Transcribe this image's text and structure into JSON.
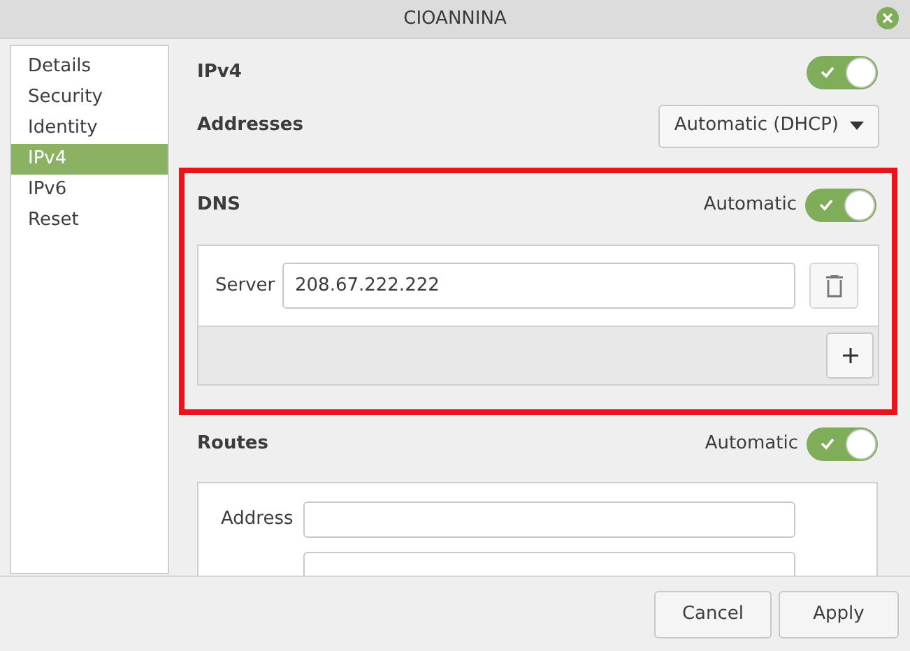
{
  "window": {
    "title": "CIOANNINA"
  },
  "sidebar": {
    "items": [
      {
        "label": "Details",
        "selected": false
      },
      {
        "label": "Security",
        "selected": false
      },
      {
        "label": "Identity",
        "selected": false
      },
      {
        "label": "IPv4",
        "selected": true
      },
      {
        "label": "IPv6",
        "selected": false
      },
      {
        "label": "Reset",
        "selected": false
      }
    ]
  },
  "ipv4": {
    "label": "IPv4",
    "on": true
  },
  "addresses": {
    "label": "Addresses",
    "method": "Automatic (DHCP)"
  },
  "dns": {
    "label": "DNS",
    "automatic_label": "Automatic",
    "automatic": true,
    "servers": [
      {
        "label": "Server",
        "value": "208.67.222.222"
      }
    ]
  },
  "routes": {
    "label": "Routes",
    "automatic_label": "Automatic",
    "automatic": true,
    "fields": [
      {
        "label": "Address"
      }
    ]
  },
  "buttons": [
    "Cancel",
    "Apply"
  ]
}
